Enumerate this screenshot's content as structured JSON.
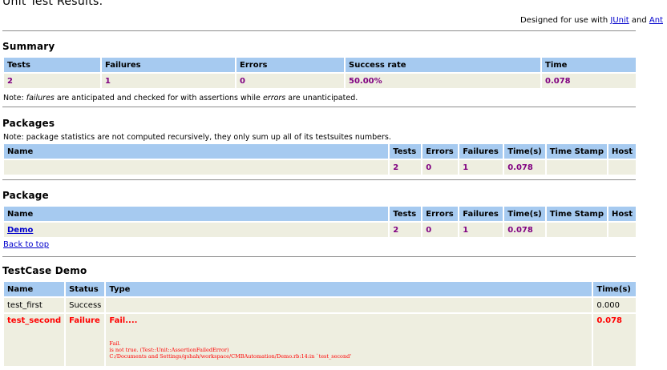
{
  "header": {
    "title": "Unit Test Results.",
    "designed_prefix": "Designed for use with ",
    "junit_link": "JUnit",
    "and": " and ",
    "ant_link": "Ant"
  },
  "summary": {
    "heading": "Summary",
    "columns": [
      "Tests",
      "Failures",
      "Errors",
      "Success rate",
      "Time"
    ],
    "row": [
      "2",
      "1",
      "0",
      "50.00%",
      "0.078"
    ],
    "note_1": "Note: ",
    "note_em1": "failures",
    "note_2": " are anticipated and checked for with assertions while ",
    "note_em2": "errors",
    "note_3": " are unanticipated."
  },
  "packages": {
    "heading": "Packages",
    "note": "Note: package statistics are not computed recursively, they only sum up all of its testsuites numbers.",
    "columns": [
      "Name",
      "Tests",
      "Errors",
      "Failures",
      "Time(s)",
      "Time Stamp",
      "Host"
    ],
    "row": [
      "",
      "2",
      "0",
      "1",
      "0.078",
      "",
      ""
    ]
  },
  "package": {
    "heading": "Package",
    "columns": [
      "Name",
      "Tests",
      "Errors",
      "Failures",
      "Time(s)",
      "Time Stamp",
      "Host"
    ],
    "row": [
      "Demo",
      "2",
      "0",
      "1",
      "0.078",
      "",
      ""
    ],
    "back_to_top": "Back to top"
  },
  "testcase": {
    "heading": "TestCase Demo",
    "columns": [
      "Name",
      "Status",
      "Type",
      "Time(s)"
    ],
    "rows": [
      {
        "name": "test_first",
        "status": "Success",
        "type": "",
        "time": "0.000"
      },
      {
        "name": "test_second",
        "status": "Failure",
        "type": "Fail....",
        "time": "0.078",
        "detail_1": "Fail.",
        "detail_2": "is not true. (Test::Unit::AssertionFailedError)",
        "detail_3": "C:/Documents and Settings/gshah/workspace/CMBAutomation/Demo.rb:14:in `test_second'"
      }
    ]
  }
}
